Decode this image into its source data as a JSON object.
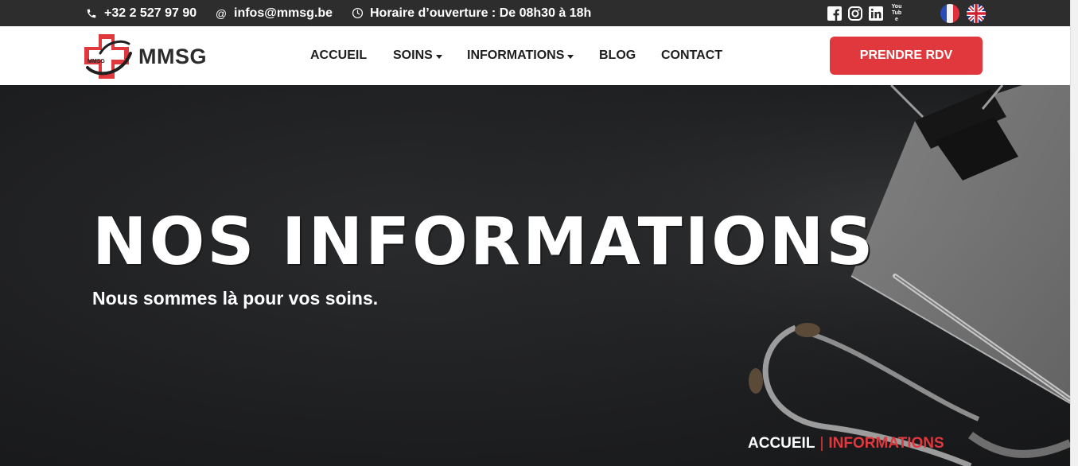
{
  "topbar": {
    "phone": "+32 2 527 97 90",
    "email": "infos@mmsg.be",
    "hours": "Horaire d’ouverture : De 08h30 à 18h",
    "social": [
      "facebook-icon",
      "instagram-icon",
      "linkedin-icon",
      "youtube-icon"
    ],
    "youtube_text": "You Tube",
    "languages": [
      "fr-flag-icon",
      "uk-flag-icon"
    ]
  },
  "logo": {
    "name": "MMSG",
    "badge": "MMSG"
  },
  "nav": {
    "items": [
      {
        "label": "ACCUEIL",
        "dropdown": false
      },
      {
        "label": "SOINS",
        "dropdown": true
      },
      {
        "label": "INFORMATIONS",
        "dropdown": true
      },
      {
        "label": "BLOG",
        "dropdown": false
      },
      {
        "label": "CONTACT",
        "dropdown": false
      }
    ],
    "cta": "PRENDRE RDV"
  },
  "hero": {
    "title": "NOS INFORMATIONS",
    "subtitle": "Nous sommes là pour vos soins."
  },
  "breadcrumb": {
    "home": "ACCUEIL",
    "separator": "|",
    "current": "INFORMATIONS"
  },
  "colors": {
    "accent": "#e0383d",
    "topbar": "#2d2d2d",
    "hero_bg": "#1d1e20"
  }
}
